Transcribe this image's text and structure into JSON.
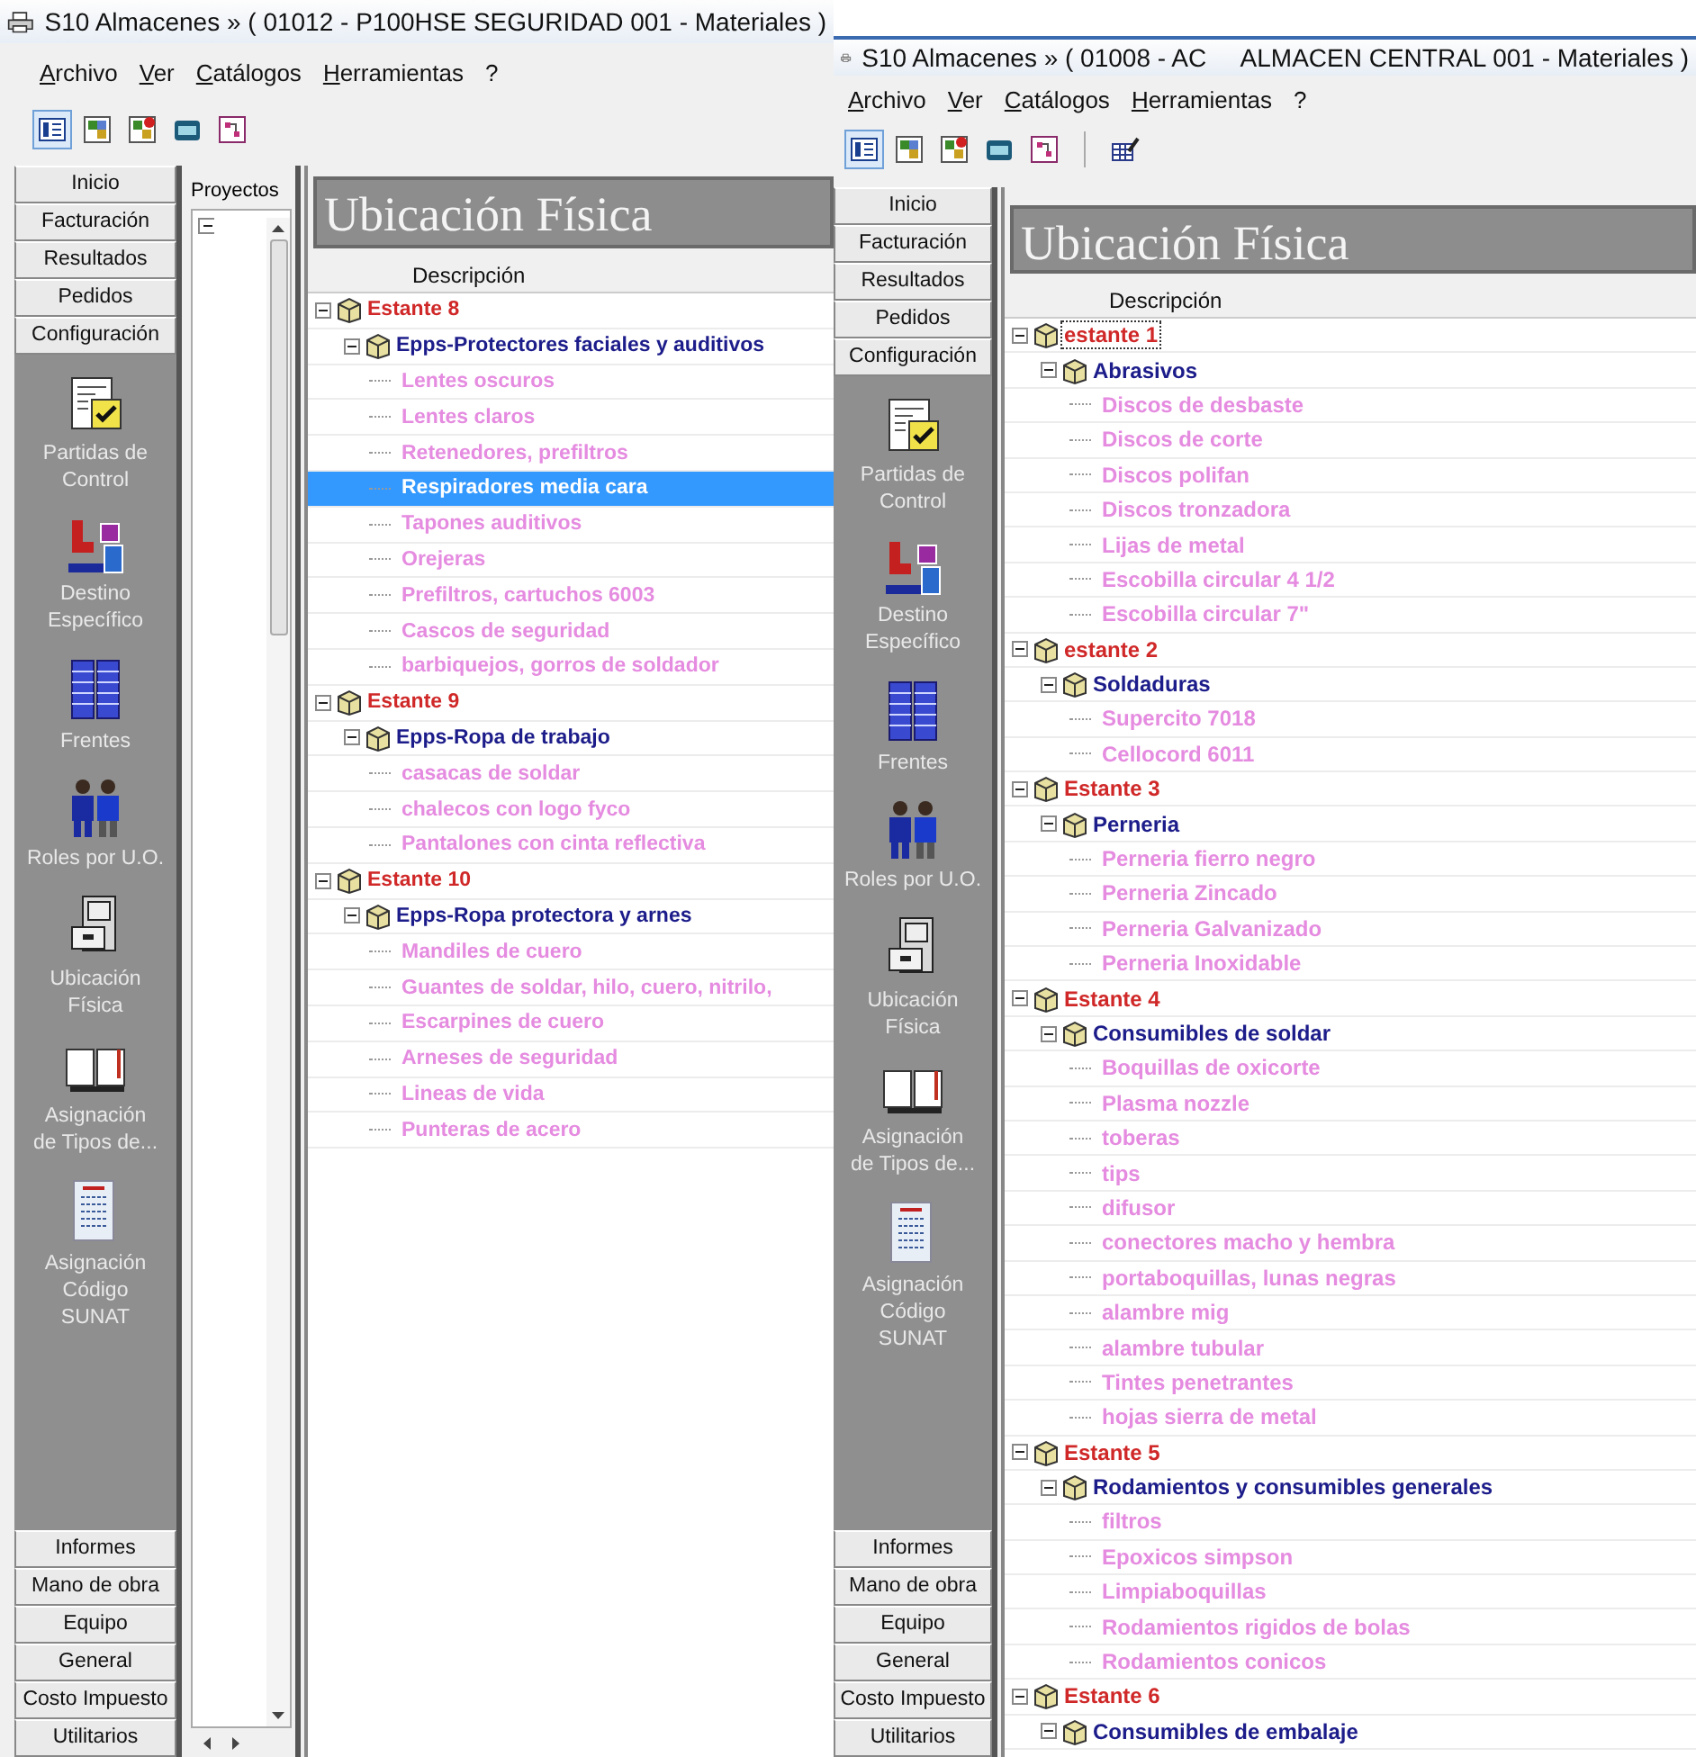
{
  "windows": [
    {
      "title": "S10 Almacenes » ( 01012 - P100HSE SEGURIDAD 001 - Materiales )",
      "menu": [
        "Archivo",
        "Ver",
        "Catálogos",
        "Herramientas",
        "?"
      ],
      "toolbar_groups": [
        [
          {
            "selected": true
          },
          {
            "selected": false
          },
          {
            "selected": false
          },
          {
            "selected": false
          },
          {
            "selected": false
          }
        ]
      ],
      "nav_top": [
        "Inicio",
        "Facturación",
        "Resultados",
        "Pedidos",
        "Configuración"
      ],
      "nav_items": [
        "Partidas de\nControl",
        "Destino\nEspecífico",
        "Frentes",
        "Roles por U.O.",
        "Ubicación\nFísica",
        "Asignación\nde Tipos de...",
        "Asignación\nCódigo\nSUNAT"
      ],
      "nav_bottom": [
        "Informes",
        "Mano de obra",
        "Equipo",
        "General",
        "Costo Impuesto",
        "Utilitarios"
      ],
      "projects_pane": {
        "label": "Proyectos",
        "expanded": true
      },
      "panel_title": "Ubicación Física",
      "column": "Descripción",
      "tree": [
        {
          "label": "Estante 8",
          "expanded": true,
          "selected": false,
          "focused": false,
          "children": [
            {
              "label": "Epps-Protectores faciales y auditivos",
              "expanded": true,
              "selected": false,
              "children": [
                {
                  "label": "Lentes oscuros",
                  "selected": false
                },
                {
                  "label": "Lentes claros",
                  "selected": false
                },
                {
                  "label": "Retenedores, prefiltros",
                  "selected": false
                },
                {
                  "label": "Respiradores media cara",
                  "selected": true
                },
                {
                  "label": "Tapones auditivos",
                  "selected": false
                },
                {
                  "label": "Orejeras",
                  "selected": false
                },
                {
                  "label": "Prefiltros, cartuchos 6003",
                  "selected": false
                },
                {
                  "label": "Cascos de seguridad",
                  "selected": false
                },
                {
                  "label": "barbiquejos, gorros de soldador",
                  "selected": false
                }
              ]
            }
          ]
        },
        {
          "label": "Estante 9",
          "expanded": true,
          "selected": false,
          "focused": false,
          "children": [
            {
              "label": "Epps-Ropa de trabajo",
              "expanded": true,
              "selected": false,
              "children": [
                {
                  "label": "casacas de soldar",
                  "selected": false
                },
                {
                  "label": "chalecos con logo fyco",
                  "selected": false
                },
                {
                  "label": "Pantalones con cinta reflectiva",
                  "selected": false
                }
              ]
            }
          ]
        },
        {
          "label": "Estante 10",
          "expanded": true,
          "selected": false,
          "focused": false,
          "children": [
            {
              "label": "Epps-Ropa protectora y arnes",
              "expanded": true,
              "selected": false,
              "children": [
                {
                  "label": "Mandiles de cuero",
                  "selected": false
                },
                {
                  "label": "Guantes de soldar, hilo, cuero, nitrilo,",
                  "selected": false
                },
                {
                  "label": "Escarpines de cuero",
                  "selected": false
                },
                {
                  "label": "Arneses de seguridad",
                  "selected": false
                },
                {
                  "label": "Lineas de vida",
                  "selected": false
                },
                {
                  "label": "Punteras de acero",
                  "selected": false
                }
              ]
            }
          ]
        }
      ]
    },
    {
      "title": "S10 Almacenes » ( 01008 - AC     ALMACEN CENTRAL 001 - Materiales )",
      "menu": [
        "Archivo",
        "Ver",
        "Catálogos",
        "Herramientas",
        "?"
      ],
      "toolbar_groups": [
        [
          {
            "selected": true
          },
          {
            "selected": false
          },
          {
            "selected": false
          },
          {
            "selected": false
          },
          {
            "selected": false
          }
        ],
        [
          {
            "selected": false
          }
        ]
      ],
      "nav_top": [
        "Inicio",
        "Facturación",
        "Resultados",
        "Pedidos",
        "Configuración"
      ],
      "nav_items": [
        "Partidas de\nControl",
        "Destino\nEspecífico",
        "Frentes",
        "Roles por U.O.",
        "Ubicación\nFísica",
        "Asignación\nde Tipos de...",
        "Asignación\nCódigo\nSUNAT"
      ],
      "nav_bottom": [
        "Informes",
        "Mano de obra",
        "Equipo",
        "General",
        "Costo Impuesto",
        "Utilitarios"
      ],
      "panel_title": "Ubicación Física",
      "column": "Descripción",
      "tree": [
        {
          "label": "estante 1",
          "expanded": true,
          "selected": false,
          "focused": true,
          "children": [
            {
              "label": "Abrasivos",
              "expanded": true,
              "selected": false,
              "children": [
                {
                  "label": "Discos de desbaste",
                  "selected": false
                },
                {
                  "label": "Discos de corte",
                  "selected": false
                },
                {
                  "label": "Discos polifan",
                  "selected": false
                },
                {
                  "label": "Discos tronzadora",
                  "selected": false
                },
                {
                  "label": "Lijas de metal",
                  "selected": false
                },
                {
                  "label": "Escobilla circular 4 1/2",
                  "selected": false
                },
                {
                  "label": "Escobilla circular 7\"",
                  "selected": false
                }
              ]
            }
          ]
        },
        {
          "label": "estante 2",
          "expanded": true,
          "selected": false,
          "focused": false,
          "children": [
            {
              "label": "Soldaduras",
              "expanded": true,
              "selected": false,
              "children": [
                {
                  "label": "Supercito 7018",
                  "selected": false
                },
                {
                  "label": "Cellocord 6011",
                  "selected": false
                }
              ]
            }
          ]
        },
        {
          "label": "Estante 3",
          "expanded": true,
          "selected": false,
          "focused": false,
          "children": [
            {
              "label": "Perneria",
              "expanded": true,
              "selected": false,
              "children": [
                {
                  "label": "Perneria fierro negro",
                  "selected": false
                },
                {
                  "label": "Perneria Zincado",
                  "selected": false
                },
                {
                  "label": "Perneria Galvanizado",
                  "selected": false
                },
                {
                  "label": "Perneria Inoxidable",
                  "selected": false
                }
              ]
            }
          ]
        },
        {
          "label": "Estante 4",
          "expanded": true,
          "selected": false,
          "focused": false,
          "children": [
            {
              "label": "Consumibles de soldar",
              "expanded": true,
              "selected": false,
              "children": [
                {
                  "label": "Boquillas de oxicorte",
                  "selected": false
                },
                {
                  "label": "Plasma nozzle",
                  "selected": false
                },
                {
                  "label": "toberas",
                  "selected": false
                },
                {
                  "label": "tips",
                  "selected": false
                },
                {
                  "label": "difusor",
                  "selected": false
                },
                {
                  "label": "conectores macho y hembra",
                  "selected": false
                },
                {
                  "label": "portaboquillas, lunas negras",
                  "selected": false
                },
                {
                  "label": "alambre mig",
                  "selected": false
                },
                {
                  "label": "alambre tubular",
                  "selected": false
                },
                {
                  "label": "Tintes penetrantes",
                  "selected": false
                },
                {
                  "label": "hojas sierra de metal",
                  "selected": false
                }
              ]
            }
          ]
        },
        {
          "label": "Estante 5",
          "expanded": true,
          "selected": false,
          "focused": false,
          "children": [
            {
              "label": "Rodamientos y consumibles generales",
              "expanded": true,
              "selected": false,
              "children": [
                {
                  "label": "filtros",
                  "selected": false
                },
                {
                  "label": "Epoxicos simpson",
                  "selected": false
                },
                {
                  "label": "Limpiaboquillas",
                  "selected": false
                },
                {
                  "label": "Rodamientos rigidos de bolas",
                  "selected": false
                },
                {
                  "label": "Rodamientos conicos",
                  "selected": false
                }
              ]
            }
          ]
        },
        {
          "label": "Estante 6",
          "expanded": true,
          "selected": false,
          "focused": false,
          "children": [
            {
              "label": "Consumibles de embalaje",
              "expanded": true,
              "selected": false
            }
          ]
        }
      ]
    }
  ]
}
